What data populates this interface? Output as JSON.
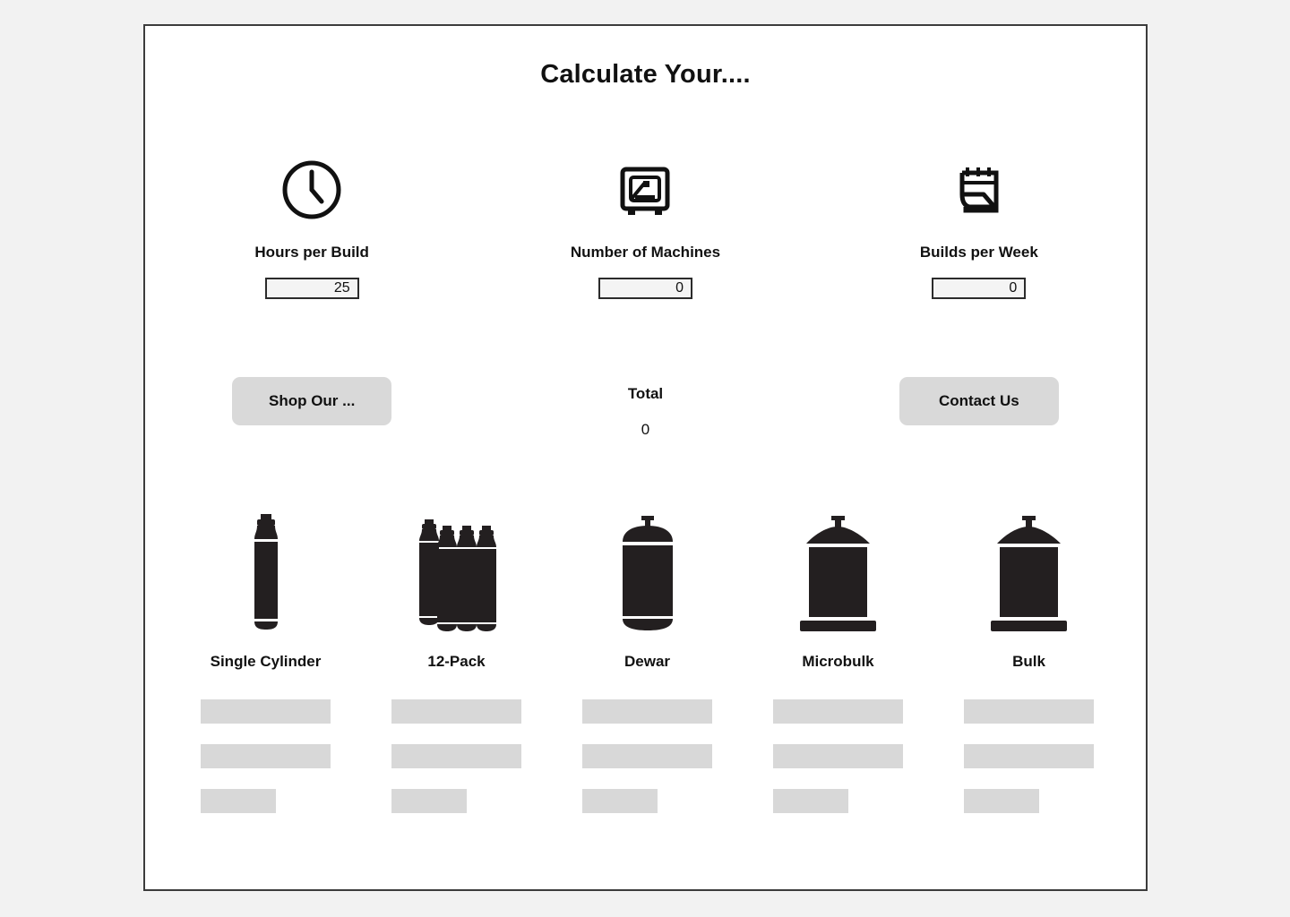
{
  "page": {
    "title": "Calculate Your....",
    "frame_border_color": "#3c3c3c",
    "background_color": "#f2f2f2",
    "surface_color": "#ffffff"
  },
  "metrics": [
    {
      "icon": "clock-icon",
      "label": "Hours per Build",
      "value": "25",
      "placeholder": "0"
    },
    {
      "icon": "3d-printer-icon",
      "label": "Number of Machines",
      "value": "0",
      "placeholder": "0"
    },
    {
      "icon": "calendar-icon",
      "label": "Builds per Week",
      "value": "0",
      "placeholder": "0"
    }
  ],
  "actions": {
    "shop_button_label": "Shop Our ...",
    "total_label": "Total",
    "total_value": "0",
    "contact_button_label": "Contact Us",
    "button_color": "#d9d9d9"
  },
  "products": [
    {
      "icon": "gas-cylinder-single-icon",
      "label": "Single Cylinder"
    },
    {
      "icon": "gas-cylinder-12pack-icon",
      "label": "12-Pack"
    },
    {
      "icon": "dewar-tank-icon",
      "label": "Dewar"
    },
    {
      "icon": "microbulk-tank-icon",
      "label": "Microbulk"
    },
    {
      "icon": "bulk-tank-icon",
      "label": "Bulk"
    }
  ],
  "placeholder_bars": {
    "fill_color": "#d8d8d8",
    "rows_per_product": 3
  }
}
